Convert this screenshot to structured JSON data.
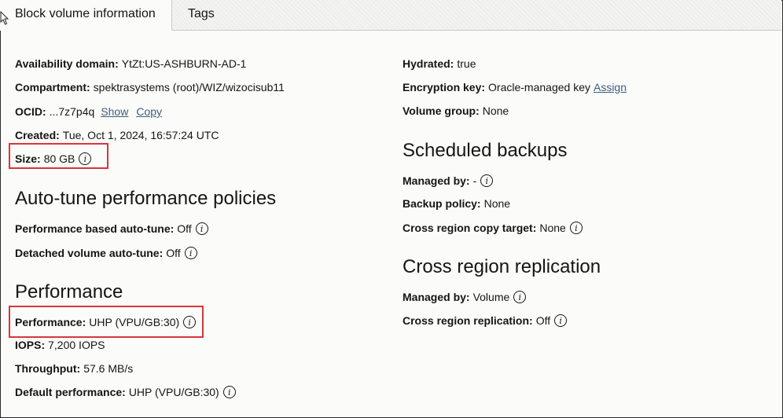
{
  "tabs": [
    {
      "label": "Block volume information",
      "active": true
    },
    {
      "label": "Tags",
      "active": false
    }
  ],
  "left": {
    "availability_domain": {
      "label": "Availability domain:",
      "value": "YtZt:US-ASHBURN-AD-1"
    },
    "compartment": {
      "label": "Compartment:",
      "value": "spektrasystems (root)/WIZ/wizocisub11"
    },
    "ocid": {
      "label": "OCID:",
      "value": "...7z7p4q",
      "show": "Show",
      "copy": "Copy"
    },
    "created": {
      "label": "Created:",
      "value": "Tue, Oct 1, 2024, 16:57:24 UTC"
    },
    "size": {
      "label": "Size:",
      "value": "80 GB"
    },
    "autotune_heading": "Auto-tune performance policies",
    "perf_autotune": {
      "label": "Performance based auto-tune:",
      "value": "Off"
    },
    "detached_autotune": {
      "label": "Detached volume auto-tune:",
      "value": "Off"
    },
    "performance_heading": "Performance",
    "performance": {
      "label": "Performance:",
      "value": "UHP (VPU/GB:30)"
    },
    "iops": {
      "label": "IOPS:",
      "value": "7,200 IOPS"
    },
    "throughput": {
      "label": "Throughput:",
      "value": "57.6 MB/s"
    },
    "default_performance": {
      "label": "Default performance:",
      "value": "UHP (VPU/GB:30)"
    }
  },
  "right": {
    "hydrated": {
      "label": "Hydrated:",
      "value": "true"
    },
    "encryption": {
      "label": "Encryption key:",
      "value": "Oracle-managed key",
      "assign": "Assign"
    },
    "volume_group": {
      "label": "Volume group:",
      "value": "None"
    },
    "backups_heading": "Scheduled backups",
    "backup_managed_by": {
      "label": "Managed by:",
      "value": "-"
    },
    "backup_policy": {
      "label": "Backup policy:",
      "value": "None"
    },
    "copy_target": {
      "label": "Cross region copy target:",
      "value": "None"
    },
    "replication_heading": "Cross region replication",
    "repl_managed_by": {
      "label": "Managed by:",
      "value": "Volume"
    },
    "replication": {
      "label": "Cross region replication:",
      "value": "Off"
    }
  },
  "info_glyph": "i",
  "colors": {
    "highlight": "#d9353b",
    "link": "#3e5d7a",
    "text": "#161513"
  }
}
